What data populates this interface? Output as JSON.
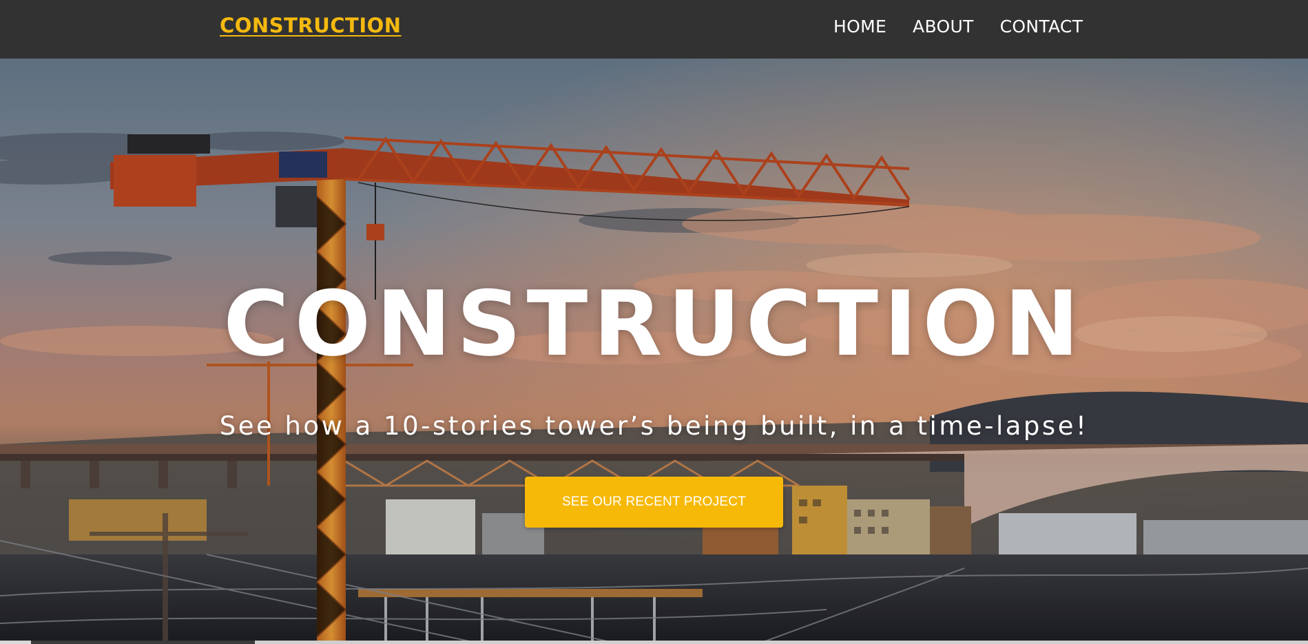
{
  "brand": {
    "logo_text": "CONSTRUCTION",
    "accent_color": "#f5b90f"
  },
  "nav": {
    "items": [
      {
        "label": "HOME"
      },
      {
        "label": "ABOUT"
      },
      {
        "label": "CONTACT"
      }
    ]
  },
  "hero": {
    "title": "CONSTRUCTION",
    "subtitle": "See how a 10-stories tower’s being built, in a time-lapse!",
    "cta_label": "SEE OUR RECENT PROJECT",
    "cta_color": "#f7b908",
    "background_scene": "crane-and-bridge-at-sunset"
  }
}
